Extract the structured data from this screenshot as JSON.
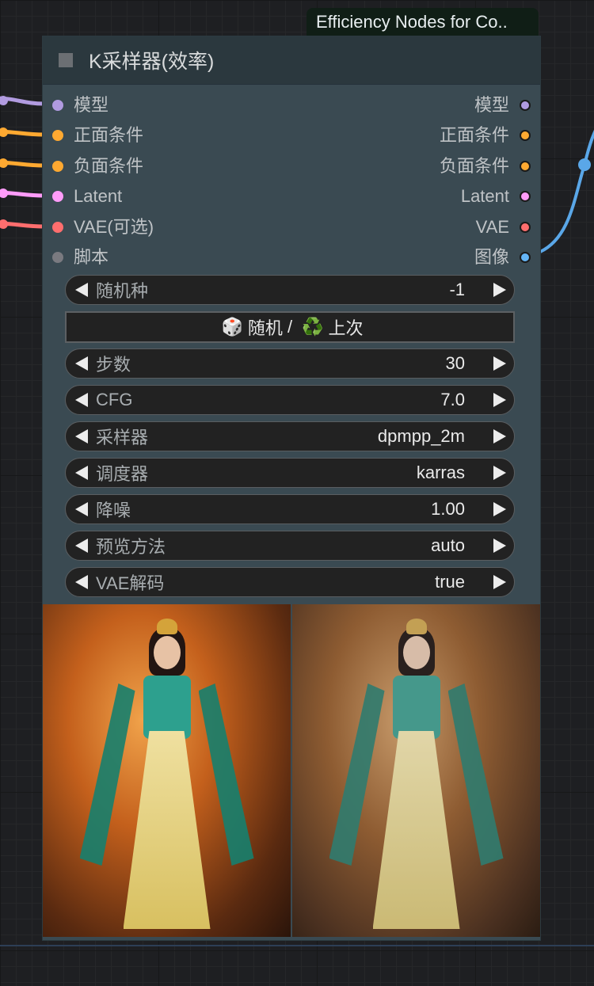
{
  "badge": {
    "text": "Efficiency Nodes for Co.."
  },
  "node": {
    "title": "K采样器(效率)",
    "inputs": [
      {
        "label": "模型",
        "color": "#b19be0"
      },
      {
        "label": "正面条件",
        "color": "#ffa931"
      },
      {
        "label": "负面条件",
        "color": "#ffa931"
      },
      {
        "label": "Latent",
        "color": "#ff9cf9"
      },
      {
        "label": "VAE(可选)",
        "color": "#ff6e6e"
      },
      {
        "label": "脚本",
        "color": "#7a7a80"
      }
    ],
    "outputs": [
      {
        "label": "模型",
        "color": "#b19be0"
      },
      {
        "label": "正面条件",
        "color": "#ffa931"
      },
      {
        "label": "负面条件",
        "color": "#ffa931"
      },
      {
        "label": "Latent",
        "color": "#ff9cf9"
      },
      {
        "label": "VAE",
        "color": "#ff6e6e"
      },
      {
        "label": "图像",
        "color": "#64b5f6"
      }
    ],
    "widgets": [
      {
        "label": "随机种",
        "value": "-1"
      },
      {
        "label": "步数",
        "value": "30"
      },
      {
        "label": "CFG",
        "value": "7.0"
      },
      {
        "label": "采样器",
        "value": "dpmpp_2m"
      },
      {
        "label": "调度器",
        "value": "karras"
      },
      {
        "label": "降噪",
        "value": "1.00"
      },
      {
        "label": "预览方法",
        "value": "auto"
      },
      {
        "label": "VAE解码",
        "value": "true"
      }
    ],
    "random_button": {
      "dice_icon": "🎲",
      "random_label": "随机",
      "separator": "/",
      "recycle_icon": "♻️",
      "last_label": "上次"
    },
    "preview_images": [
      "decoded-image",
      "preview-image"
    ]
  },
  "colors": {
    "image_link": "#5aa7e8",
    "model_link": "#b19be0",
    "cond_link": "#ffa931",
    "latent_link": "#ff9cf9",
    "vae_link": "#ff6e6e"
  }
}
